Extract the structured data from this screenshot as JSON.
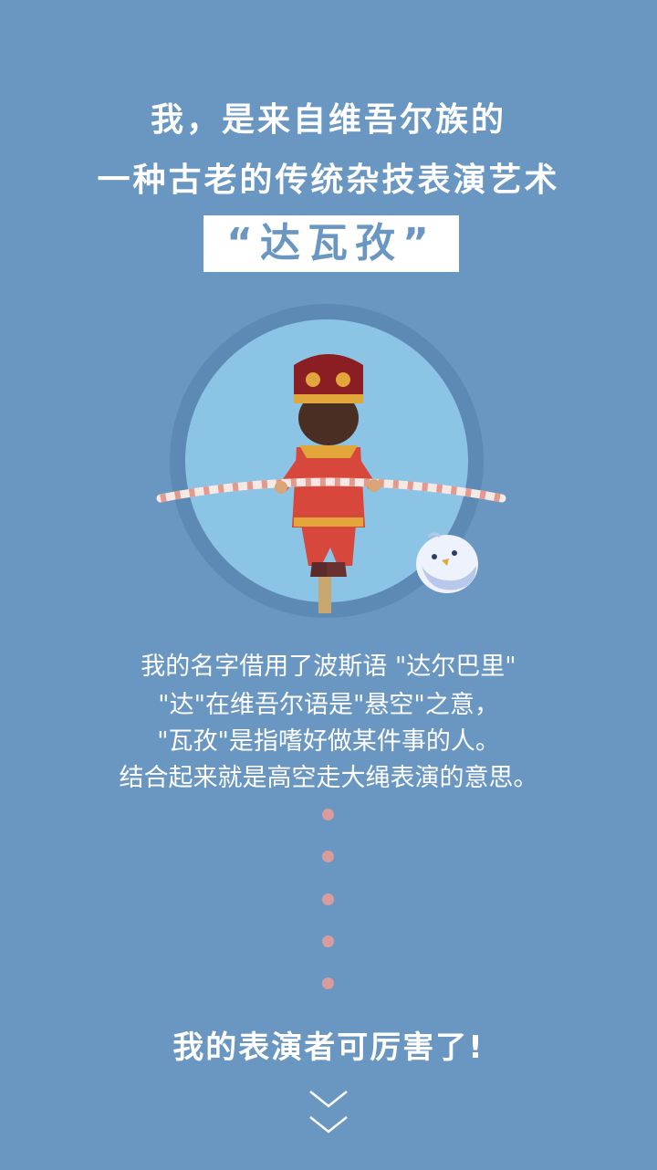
{
  "headline": {
    "line1": "我，是来自维吾尔族的",
    "line2": "一种古老的传统杂技表演艺术",
    "name": "“达瓦孜”"
  },
  "description": {
    "line1": "我的名字借用了波斯语 \"达尔巴里\"",
    "line2": "\"达\"在维吾尔语是\"悬空\"之意，",
    "line3": "\"瓦孜\"是指嗜好做某件事的人。",
    "line4": "结合起来就是高空走大绳表演的意思。"
  },
  "closing": "我的表演者可厉害了!",
  "icons": {
    "scroll": "double-chevron-down-icon",
    "illustration": "tightrope-walker-illustration",
    "bird": "bird-icon"
  },
  "colors": {
    "background": "#6a97c1",
    "circle_outer": "#5d8ab4",
    "circle_inner": "#8cc4e6",
    "dot": "#d99c9c",
    "costume": "#d8473c"
  }
}
